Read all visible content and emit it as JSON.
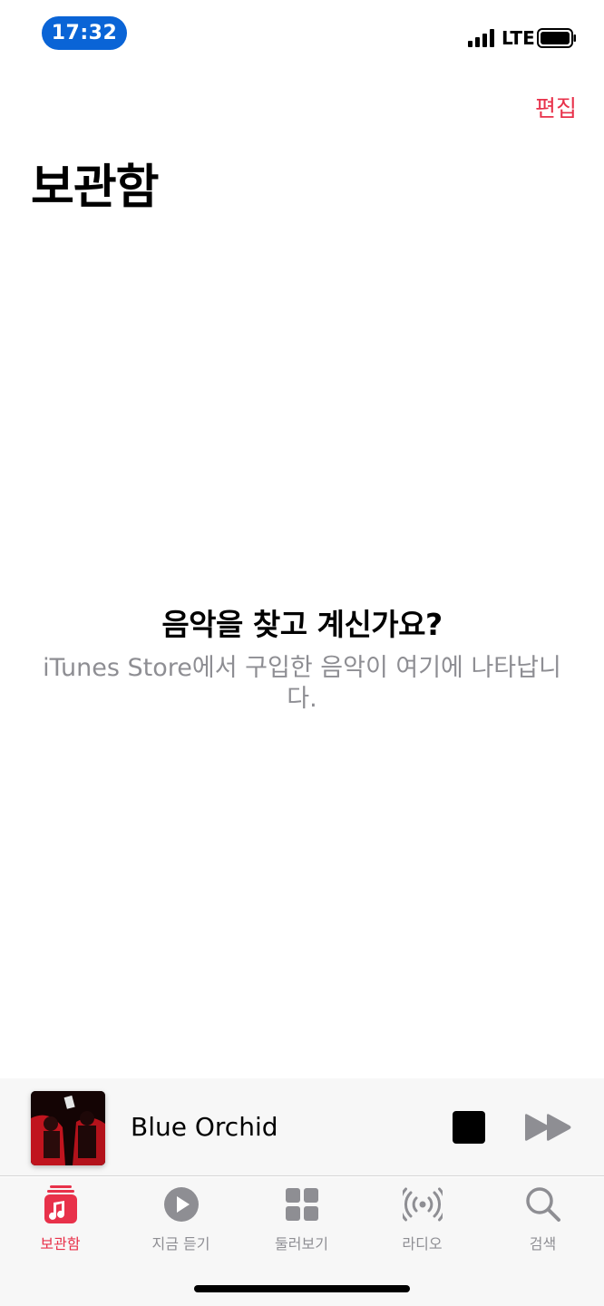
{
  "status_bar": {
    "time": "17:32",
    "network": "LTE"
  },
  "header": {
    "edit_label": "편집",
    "title": "보관함"
  },
  "empty_state": {
    "heading": "음악을 찾고 계신가요?",
    "description": "iTunes Store에서 구입한 음악이 여기에 나타납니다."
  },
  "mini_player": {
    "track_title": "Blue Orchid",
    "icons": [
      "album-art",
      "stop-icon",
      "fast-forward-icon"
    ]
  },
  "tab_bar": {
    "tabs": [
      {
        "label": "보관함",
        "icon": "library-icon",
        "active": true
      },
      {
        "label": "지금 듣기",
        "icon": "play-circle-icon",
        "active": false
      },
      {
        "label": "둘러보기",
        "icon": "browse-grid-icon",
        "active": false
      },
      {
        "label": "라디오",
        "icon": "radio-icon",
        "active": false
      },
      {
        "label": "검색",
        "icon": "search-icon",
        "active": false
      }
    ]
  },
  "colors": {
    "accent": "#e8314a",
    "time_pill": "#0a64d6",
    "secondary_text": "#8e8e93",
    "tab_inactive": "#8e8e93"
  }
}
